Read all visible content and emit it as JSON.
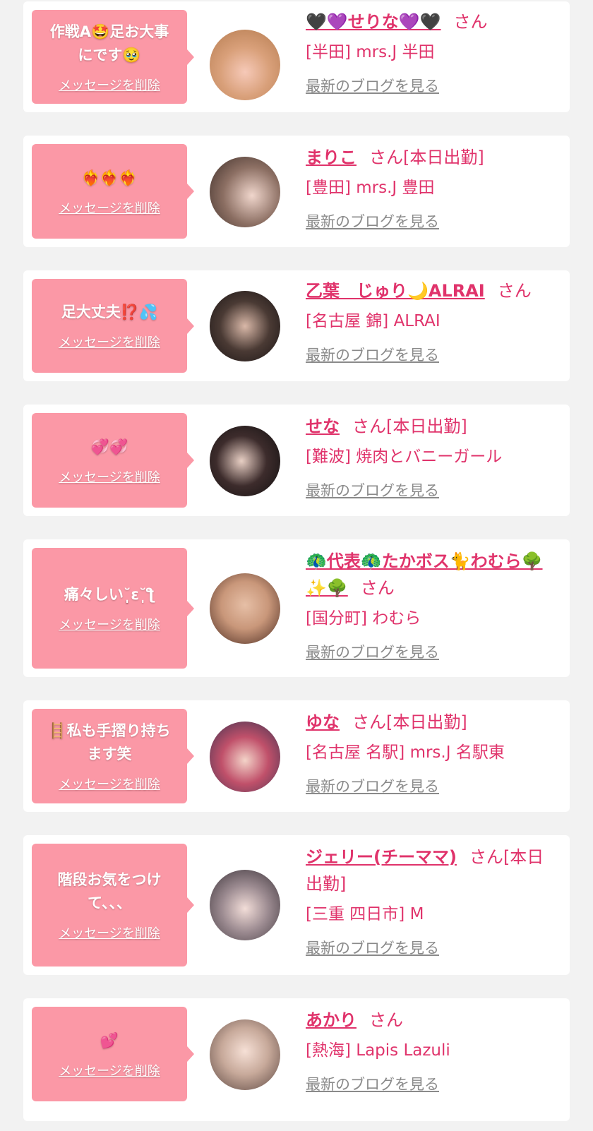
{
  "delete_label": "メッセージを削除",
  "blog_label": "最新のブログを見る",
  "san_label": "さん",
  "colors": {
    "accent": "#e0336b",
    "bubble": "#fb98a6",
    "link_gray": "#8a8a8a",
    "background": "#f2f2f2"
  },
  "cards": [
    {
      "message": "作戦A🤩足お大事\nにです🥹",
      "name": "🖤💜せりな💜🖤",
      "status": "",
      "shop": "[半田] mrs.J 半田"
    },
    {
      "message": "❤️‍🔥❤️‍🔥❤️‍🔥",
      "name": "まりこ",
      "status": "[本日出勤]",
      "shop": "[豊田] mrs.J 豊田"
    },
    {
      "message": "足大丈夫⁉️💦",
      "name": "乙葉　じゅり🌙ALRAI",
      "status": "",
      "shop": "[名古屋 錦] ALRAI"
    },
    {
      "message": "💞💞",
      "name": "せな",
      "status": "[本日出勤]",
      "shop": "[難波] 焼肉とバニーガール"
    },
    {
      "message": "痛々しい˘̩̩̩ε˘̩ƪ",
      "name": "🦚代表🦚たかボス🐈わむら🌳✨🌳",
      "status": "",
      "shop": "[国分町] わむら"
    },
    {
      "message": "🪜私も手摺り持ち\nます笑",
      "name": "ゆな",
      "status": "[本日出勤]",
      "shop": "[名古屋 名駅] mrs.J 名駅東"
    },
    {
      "message": "階段お気をつけ\nて、、、",
      "name": "ジェリー(チーママ)",
      "status": "[本日出勤]",
      "shop": "[三重 四日市] M"
    },
    {
      "message": "💕",
      "name": "あかり",
      "status": "",
      "shop": "[熱海] Lapis Lazuli"
    }
  ]
}
